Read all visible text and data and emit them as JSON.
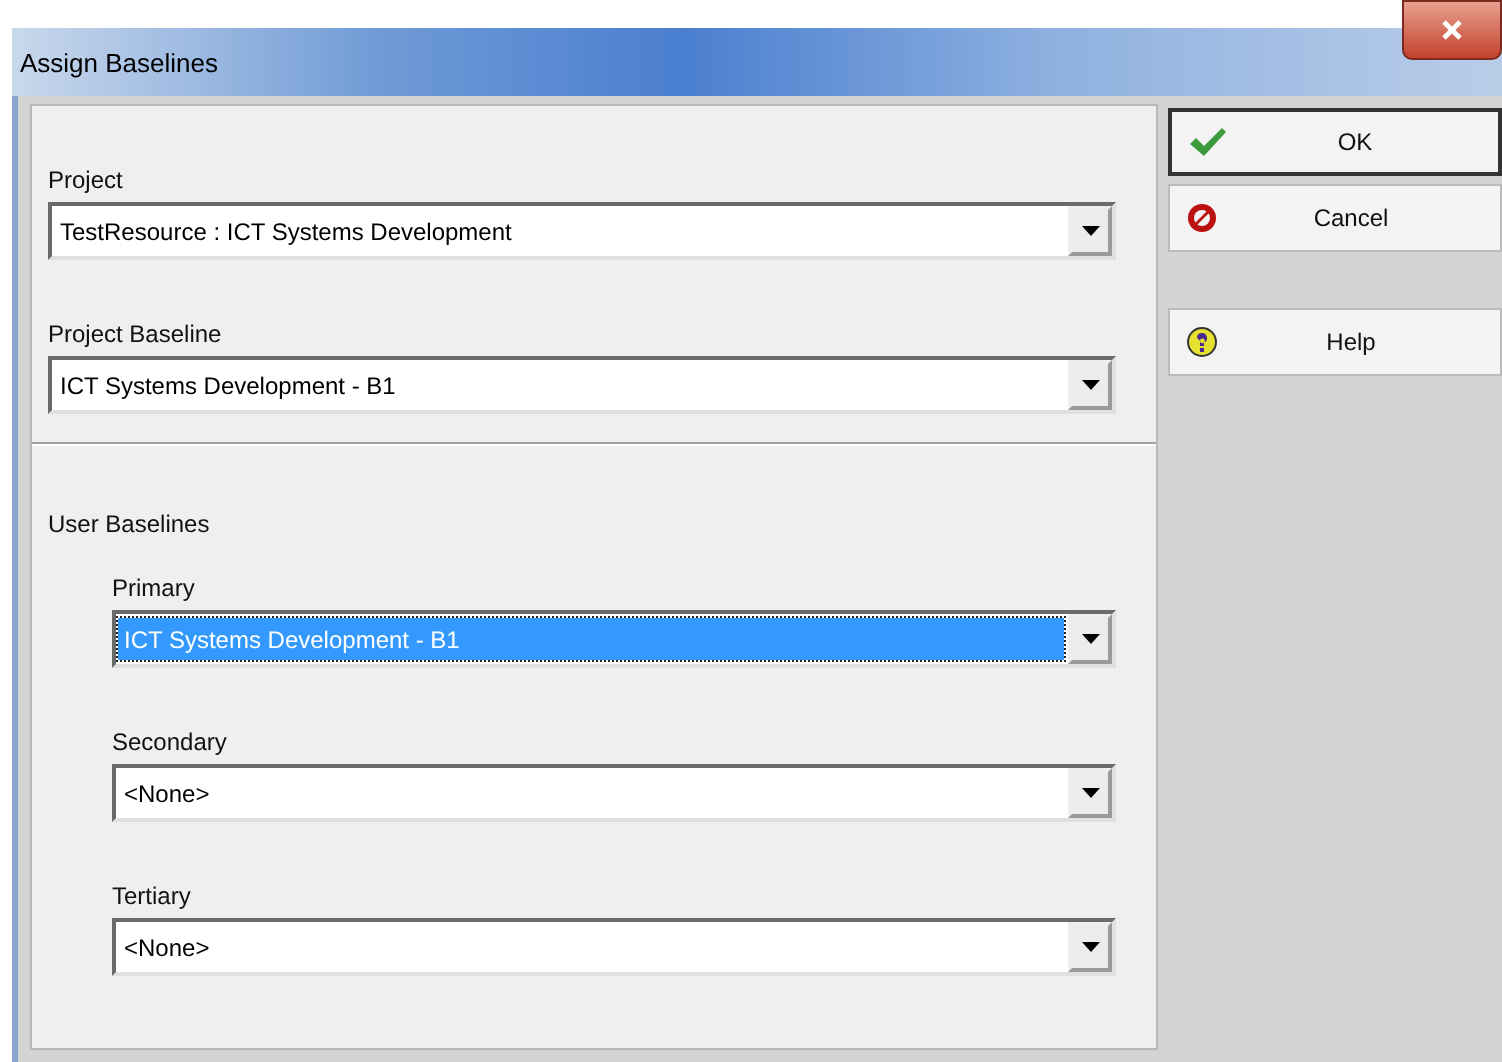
{
  "window": {
    "title": "Assign Baselines"
  },
  "project": {
    "label": "Project",
    "value": "TestResource : ICT Systems Development"
  },
  "project_baseline": {
    "label": "Project Baseline",
    "value": "ICT Systems Development - B1"
  },
  "user_baselines": {
    "label": "User Baselines",
    "fields": [
      {
        "label": "Primary",
        "value": "ICT Systems Development - B1",
        "selected": true
      },
      {
        "label": "Secondary",
        "value": "<None>",
        "selected": false
      },
      {
        "label": "Tertiary",
        "value": "<None>",
        "selected": false
      }
    ]
  },
  "buttons": [
    {
      "label": "OK",
      "kind": "ok",
      "default": true
    },
    {
      "label": "Cancel",
      "kind": "cancel",
      "default": false
    },
    {
      "label": "Help",
      "kind": "help",
      "default": false
    }
  ]
}
